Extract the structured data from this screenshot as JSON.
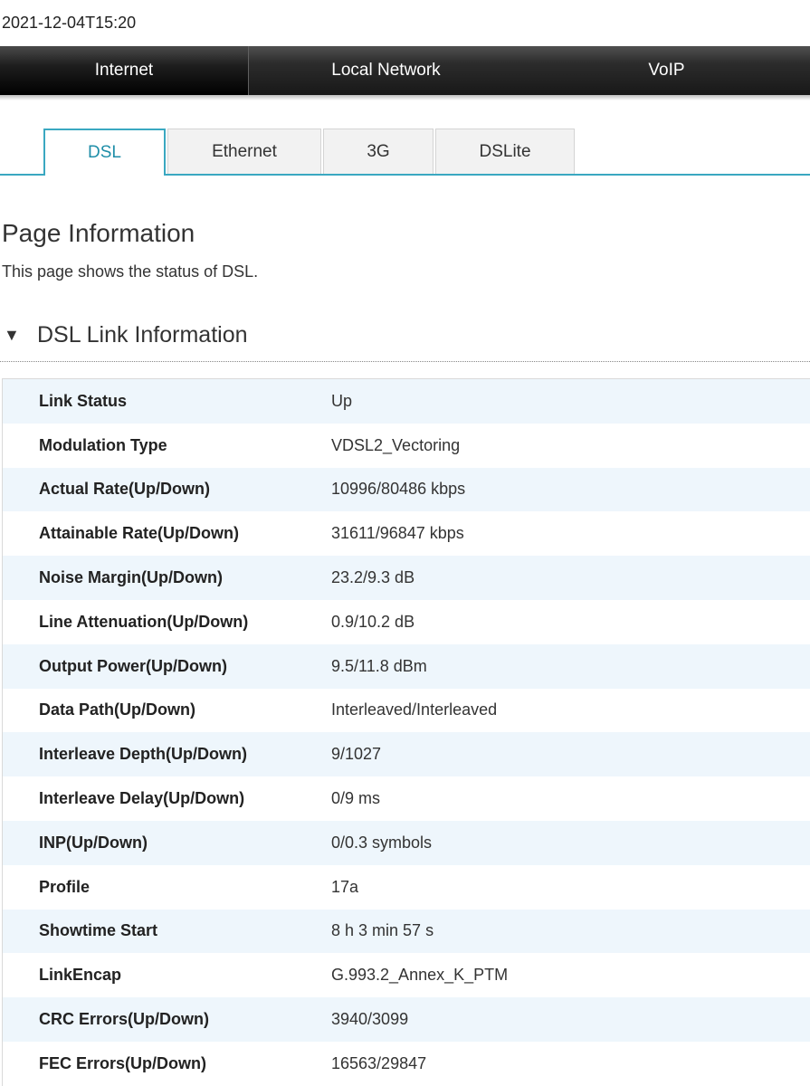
{
  "timestamp": "2021-12-04T15:20",
  "top_nav": {
    "tabs": [
      {
        "label": "Internet",
        "active": true
      },
      {
        "label": "Local Network",
        "active": false
      },
      {
        "label": "VoIP",
        "active": false
      }
    ]
  },
  "sub_tabs": [
    {
      "label": "DSL",
      "active": true
    },
    {
      "label": "Ethernet",
      "active": false
    },
    {
      "label": "3G",
      "active": false
    },
    {
      "label": "DSLite",
      "active": false
    }
  ],
  "page": {
    "title": "Page Information",
    "description": "This page shows the status of DSL."
  },
  "section": {
    "title": "DSL Link Information",
    "expanded": true,
    "rows": [
      {
        "label": "Link Status",
        "value": "Up"
      },
      {
        "label": "Modulation Type",
        "value": "VDSL2_Vectoring"
      },
      {
        "label": "Actual Rate(Up/Down)",
        "value": "10996/80486 kbps"
      },
      {
        "label": "Attainable Rate(Up/Down)",
        "value": "31611/96847 kbps"
      },
      {
        "label": "Noise Margin(Up/Down)",
        "value": "23.2/9.3 dB"
      },
      {
        "label": "Line Attenuation(Up/Down)",
        "value": "0.9/10.2 dB"
      },
      {
        "label": "Output Power(Up/Down)",
        "value": "9.5/11.8 dBm"
      },
      {
        "label": "Data Path(Up/Down)",
        "value": "Interleaved/Interleaved"
      },
      {
        "label": "Interleave Depth(Up/Down)",
        "value": "9/1027"
      },
      {
        "label": "Interleave Delay(Up/Down)",
        "value": "0/9 ms"
      },
      {
        "label": "INP(Up/Down)",
        "value": "0/0.3 symbols"
      },
      {
        "label": "Profile",
        "value": "17a"
      },
      {
        "label": "Showtime Start",
        "value": "8 h 3 min 57 s"
      },
      {
        "label": "LinkEncap",
        "value": "G.993.2_Annex_K_PTM"
      },
      {
        "label": "CRC Errors(Up/Down)",
        "value": "3940/3099"
      },
      {
        "label": "FEC Errors(Up/Down)",
        "value": "16563/29847"
      }
    ]
  },
  "colors": {
    "accent": "#3aa8c1",
    "active_subtab_text": "#1f8ea8",
    "row_alt_bg": "#eef6fc"
  }
}
